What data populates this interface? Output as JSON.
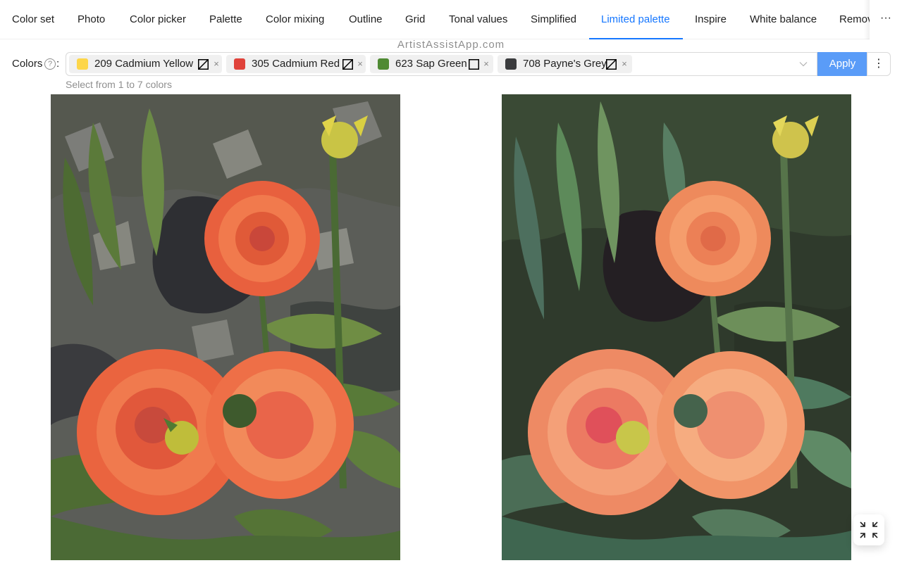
{
  "tabs": [
    {
      "label": "Color set"
    },
    {
      "label": "Photo"
    },
    {
      "label": "Color picker"
    },
    {
      "label": "Palette"
    },
    {
      "label": "Color mixing"
    },
    {
      "label": "Outline"
    },
    {
      "label": "Grid"
    },
    {
      "label": "Tonal values"
    },
    {
      "label": "Simplified"
    },
    {
      "label": "Limited palette"
    },
    {
      "label": "Inspire"
    },
    {
      "label": "White balance"
    },
    {
      "label": "Remov"
    }
  ],
  "active_tab": "Limited palette",
  "more_tabs_label": "···",
  "site_url": "ArtistAssistApp.com",
  "colors_field": {
    "label": "Colors",
    "help": "?",
    "colon": ":",
    "hint": "Select from 1 to 7 colors",
    "selected": [
      {
        "label": "209 Cadmium Yellow",
        "color": "#fdd64a",
        "icon": "opaque-stroke-icon"
      },
      {
        "label": "305 Cadmium Red",
        "color": "#e0423a",
        "icon": "opaque-stroke-icon"
      },
      {
        "label": "623 Sap Green",
        "color": "#4f8a33",
        "icon": "transparent-square-icon"
      },
      {
        "label": "708 Payne's Grey",
        "color": "#3a3b3d",
        "icon": "opaque-stroke-icon"
      }
    ],
    "remove_glyph": "×"
  },
  "apply_label": "Apply",
  "kebab_label": "⋮",
  "colors": {
    "accent": "#1677ff",
    "apply_bg": "#5a9cf8",
    "flower_orange": "#f0764a",
    "foliage_green": "#4a6a38"
  },
  "images": [
    {
      "name": "limited-palette-result",
      "subject": "orange dahlias"
    },
    {
      "name": "original-photo",
      "subject": "orange dahlias"
    }
  ]
}
